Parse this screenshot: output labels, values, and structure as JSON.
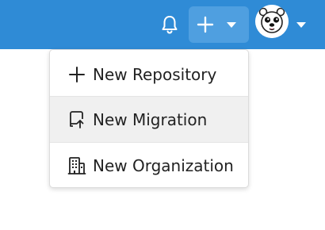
{
  "navbar": {
    "icons": {
      "notifications": "bell-icon",
      "create": "plus-icon",
      "create_dropdown": "chevron-down-icon",
      "user_avatar": "polar-bear-avatar",
      "user_dropdown": "chevron-down-icon"
    },
    "colors": {
      "background": "#2f8bd6",
      "active_button": "#4f9fe0"
    }
  },
  "create_menu": {
    "active_item": "New Migration",
    "items": [
      {
        "label": "New Repository",
        "icon": "plus-icon"
      },
      {
        "label": "New Migration",
        "icon": "repo-push-icon"
      },
      {
        "label": "New Organization",
        "icon": "organization-icon"
      }
    ]
  }
}
